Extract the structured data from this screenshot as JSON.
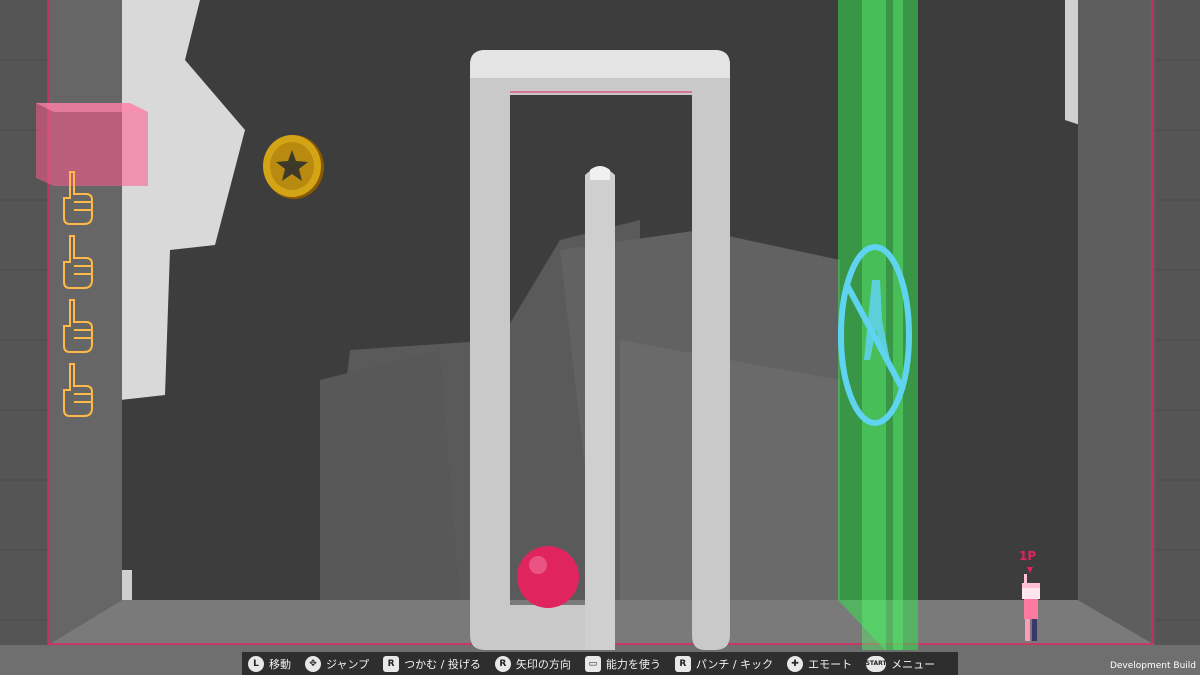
{
  "hud": {
    "player_tag": "1P",
    "lives_count": 4,
    "development_label": "Development Build"
  },
  "controls": [
    {
      "icon": "L",
      "label": "移動"
    },
    {
      "icon": "✥",
      "label": "ジャンプ"
    },
    {
      "icon": "R",
      "label": "つかむ / 投げる"
    },
    {
      "icon": "R",
      "label": "矢印の方向"
    },
    {
      "icon": "▭",
      "label": "能力を使う"
    },
    {
      "icon": "R",
      "label": "パンチ / キック"
    },
    {
      "icon": "✚",
      "label": "エモート"
    },
    {
      "icon": "START",
      "label": "メニュー"
    }
  ],
  "colors": {
    "accent_pink": "#e0245e",
    "green_barrier": "#35e04f",
    "coin_gold": "#d4a417",
    "no_entry_sign": "#5fd3f0"
  }
}
